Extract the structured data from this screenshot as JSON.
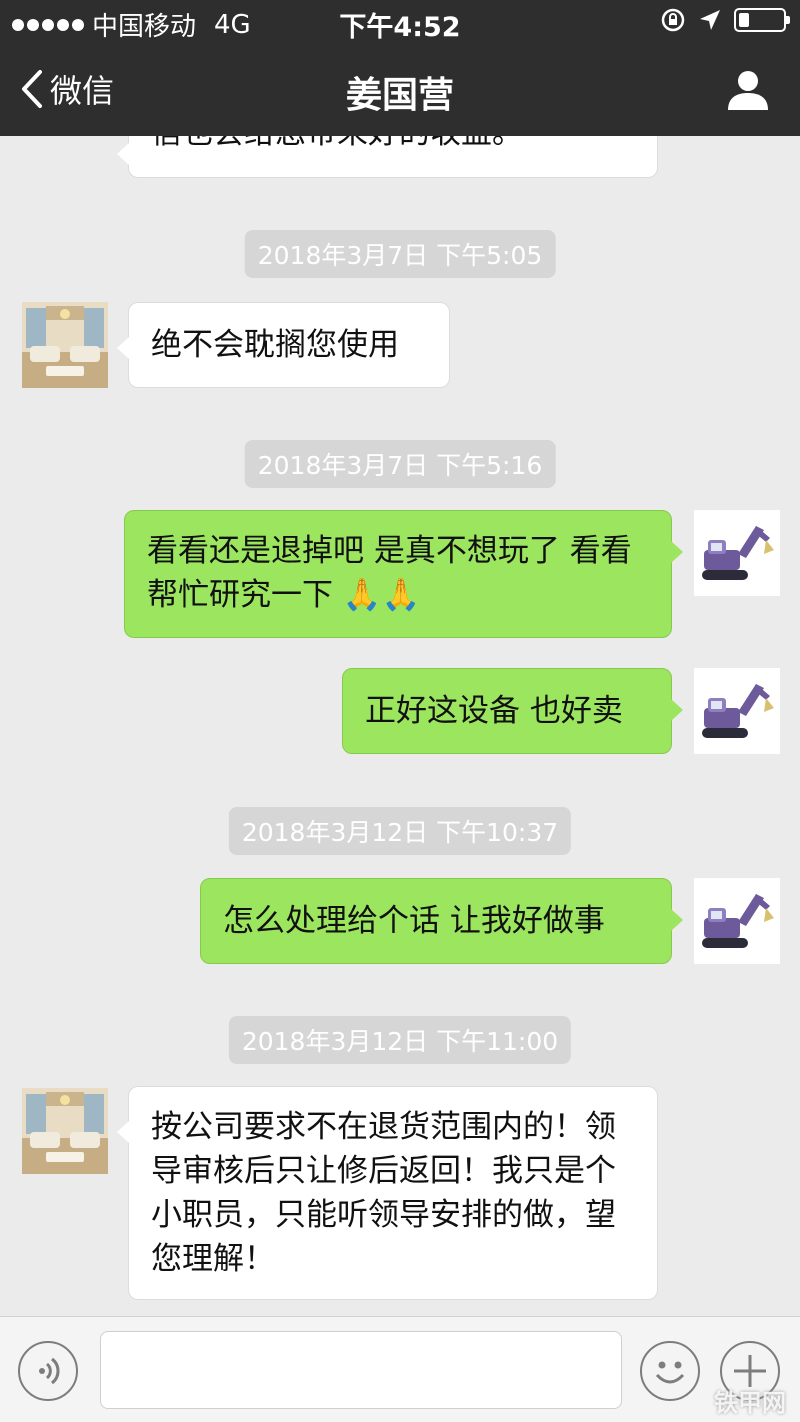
{
  "status_bar": {
    "carrier": "中国移动",
    "network": "4G",
    "time": "下午4:52"
  },
  "nav": {
    "back_label": "微信",
    "title": "姜国营"
  },
  "messages": [
    {
      "type": "in",
      "text": "信也会给您带来好的收益。"
    },
    {
      "type": "time",
      "text": "2018年3月7日 下午5:05"
    },
    {
      "type": "in",
      "text": "绝不会耽搁您使用"
    },
    {
      "type": "time",
      "text": "2018年3月7日 下午5:16"
    },
    {
      "type": "out",
      "text": "看看还是退掉吧 是真不想玩了 看看帮忙研究一下 🙏🙏"
    },
    {
      "type": "out",
      "text": "正好这设备 也好卖"
    },
    {
      "type": "time",
      "text": "2018年3月12日 下午10:37"
    },
    {
      "type": "out",
      "text": "怎么处理给个话 让我好做事"
    },
    {
      "type": "time",
      "text": "2018年3月12日 下午11:00"
    },
    {
      "type": "in",
      "text": "按公司要求不在退货范围内的！领导审核后只让修后返回！我只是个小职员，只能听领导安排的做，望您理解！"
    }
  ],
  "input_bar": {
    "watermark": "铁甲网"
  },
  "colors": {
    "nav_bg": "#2e2e2e",
    "chat_bg": "#ebebeb",
    "outgoing_bubble": "#9ce55f",
    "incoming_bubble": "#ffffff"
  },
  "icons": [
    "back-chevron-icon",
    "profile-icon",
    "voice-icon",
    "emoji-icon",
    "plus-icon",
    "signal-dots-icon",
    "location-arrow-icon",
    "orientation-lock-icon",
    "battery-icon"
  ]
}
